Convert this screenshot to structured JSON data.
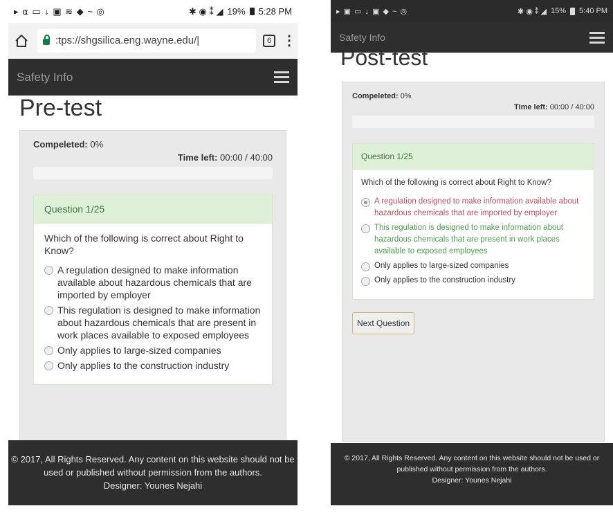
{
  "left": {
    "status": {
      "icons": "▸ ⍺ ▭ ↓ ▣ ≋ ◆ ~ ◎",
      "signal": "✱ ◉ ⁑ ◢",
      "battery": "19%",
      "time": "5:28 PM"
    },
    "browser": {
      "url": ":tps://shgsilica.eng.wayne.edu/|",
      "tab_count": "6"
    },
    "nav": {
      "brand": "Safety Info"
    },
    "page_title": "Pre-test",
    "quiz": {
      "completed_label": "Compeleted:",
      "completed_value": "0%",
      "time_label": "Time left:",
      "time_value": "00:00 / 40:00",
      "question_header": "Question 1/25",
      "question_text": "Which of the following is correct about Right to Know?",
      "options": [
        "A regulation designed to make information available about hazardous chemicals that are imported by employer",
        "This regulation is designed to make information about hazardous chemicals that are present in work places available to exposed employees",
        "Only applies to large-sized companies",
        "Only applies to the construction industry"
      ]
    },
    "footer": {
      "line1": "© 2017, All Rights Reserved. Any content on this website should not be used or published without permission from the authors.",
      "line2": "Designer: Younes Nejahi"
    }
  },
  "right": {
    "status": {
      "icons": "▸ ▣ ▭ ↓ ▣ ◆ ~ ◎",
      "signal": "✱ ◉ ⁑ ◢",
      "battery": "15%",
      "time": "5:40 PM"
    },
    "nav": {
      "brand": "Safety Info"
    },
    "page_title": "Post-test",
    "quiz": {
      "completed_label": "Compeleted:",
      "completed_value": "0%",
      "time_label": "Time left:",
      "time_value": "00:00 / 40:00",
      "question_header": "Question 1/25",
      "question_text": "Which of the following is correct about Right to Know?",
      "options": [
        "A regulation designed to make information available about hazardous chemicals that are imported by employer",
        "This regulation is designed to make information about hazardous chemicals that are present in work places available to exposed employees",
        "Only applies to large-sized companies",
        "Only applies to the construction industry"
      ],
      "next_label": "Next Question"
    },
    "footer": {
      "line1": "© 2017, All Rights Reserved. Any content on this website should not be used or published without permission from the authors.",
      "line2": "Designer: Younes Nejahi"
    }
  },
  "colors": {
    "navbar": "#2e2e2e",
    "question_header_bg": "#dff0d8",
    "question_header_text": "#3c763d",
    "wrong_answer": "#c0515a",
    "correct_answer": "#4f9e52"
  }
}
